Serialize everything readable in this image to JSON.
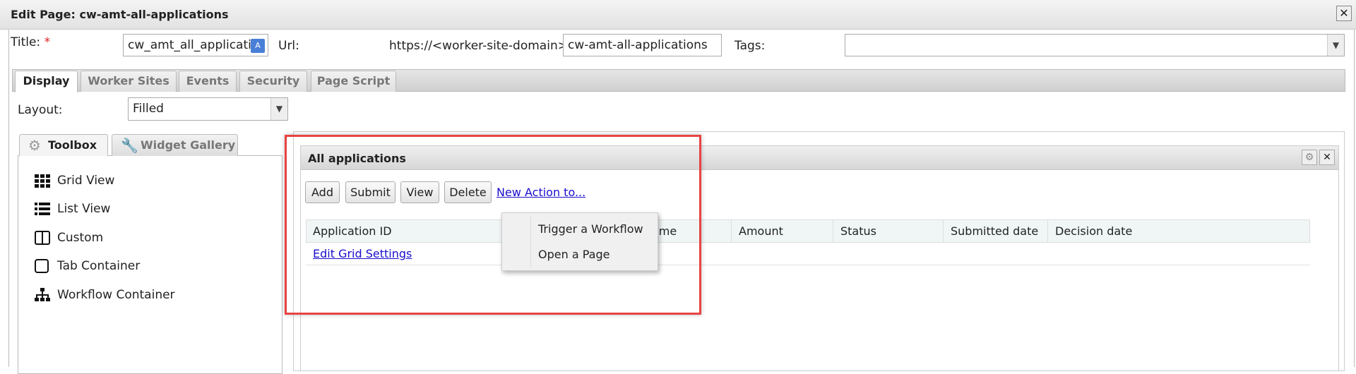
{
  "window": {
    "title": "Edit Page: cw-amt-all-applications"
  },
  "form": {
    "title_label": "Title:",
    "required_mark": "*",
    "title_value": "cw_amt_all_applicati",
    "url_label": "Url:",
    "url_prefix": "https://<worker-site-domain>/",
    "url_value": "cw-amt-all-applications",
    "tags_label": "Tags:",
    "tags_value": ""
  },
  "tabs": [
    {
      "label": "Display",
      "active": true
    },
    {
      "label": "Worker Sites"
    },
    {
      "label": "Events"
    },
    {
      "label": "Security"
    },
    {
      "label": "Page Script"
    }
  ],
  "layout": {
    "label": "Layout:",
    "value": "Filled"
  },
  "panel_tabs": [
    {
      "label": "Toolbox",
      "icon": "gear-icon",
      "active": true
    },
    {
      "label": "Widget Gallery",
      "icon": "wrench-icon"
    }
  ],
  "toolbox": [
    {
      "label": "Grid View",
      "icon": "grid-icon"
    },
    {
      "label": "List View",
      "icon": "list-icon"
    },
    {
      "label": "Custom",
      "icon": "columns-icon"
    },
    {
      "label": "Tab Container",
      "icon": "square-icon"
    },
    {
      "label": "Workflow Container",
      "icon": "hierarchy-icon"
    }
  ],
  "widget": {
    "title": "All applications",
    "buttons": [
      "Add",
      "Submit",
      "View",
      "Delete"
    ],
    "new_action": "New Action to...",
    "columns": [
      "Application ID",
      "Name",
      "Amount",
      "Status",
      "Submitted date",
      "Decision date"
    ],
    "edit_grid": "Edit Grid Settings"
  },
  "menu": [
    "Trigger a Workflow",
    "Open a Page"
  ],
  "colors": {
    "highlight": "#e84343",
    "link": "#1a0dcc"
  }
}
